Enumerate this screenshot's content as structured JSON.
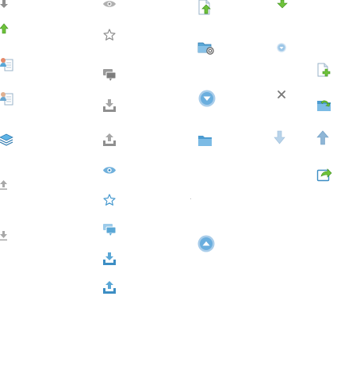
{
  "colors": {
    "gray_icon": "#9a9a9a",
    "gray_dark": "#7a7a7a",
    "blue_icon": "#5aa7d6",
    "blue_light": "#a9cdea",
    "green_icon": "#6ec23a",
    "green_dark": "#3f8f1e",
    "background": "#ffffff"
  },
  "icons": [
    "arrow-down-gray-icon",
    "arrow-up-green-icon",
    "document-user-icon",
    "document-user-icon",
    "layers-icon",
    "arrow-up-small-gray-icon",
    "arrow-down-small-gray-icon",
    "eye-gray-icon",
    "star-outline-gray-icon",
    "comment-gray-icon",
    "download-tray-gray-icon",
    "upload-tray-gray-icon",
    "eye-blue-icon",
    "star-outline-blue-icon",
    "comment-blue-icon",
    "download-tray-blue-icon",
    "upload-tray-blue-icon",
    "file-upload-icon",
    "folder-settings-icon",
    "circle-arrow-down-icon",
    "folder-icon",
    "circle-arrow-up-icon",
    "arrow-down-green-icon",
    "small-circle-arrow-down-icon",
    "close-x-icon",
    "arrow-down-light-blue-icon",
    "file-add-icon",
    "folder-undo-icon",
    "arrow-up-blue-icon",
    "share-icon"
  ]
}
